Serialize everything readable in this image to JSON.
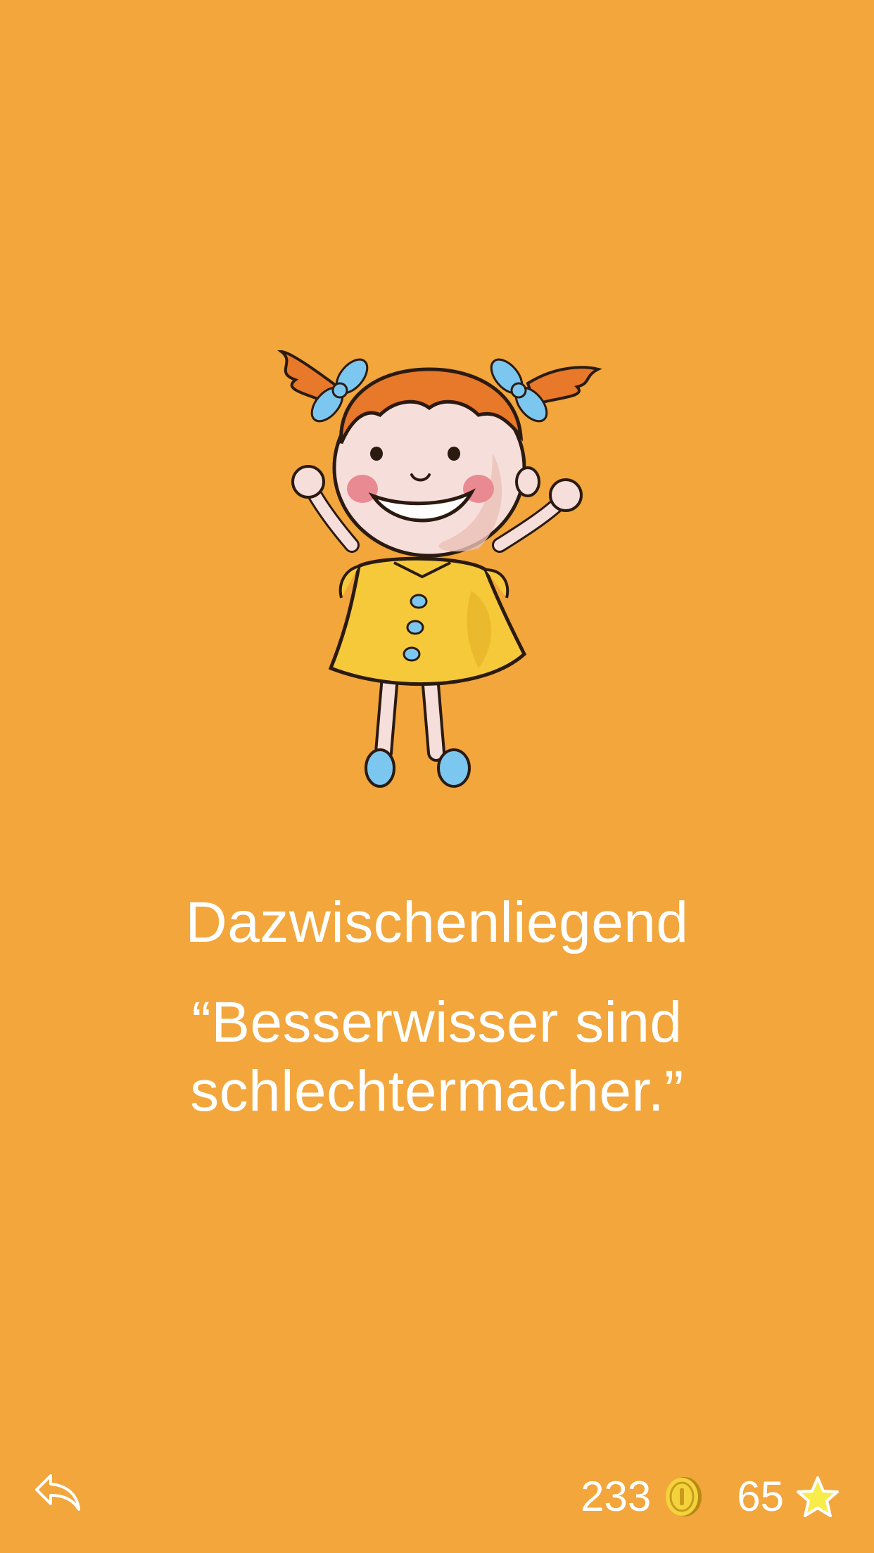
{
  "level": {
    "title": "Dazwischenliegend"
  },
  "quote": {
    "line1": "“Besserwisser sind",
    "line2": "schlechtermacher.”"
  },
  "footer": {
    "back_icon": "share-back-icon",
    "coins": "233",
    "coin_icon": "gold-coin-icon",
    "stars": "65",
    "star_icon": "yellow-star-icon"
  },
  "colors": {
    "background": "#F2A63C",
    "text": "#FFFFFF",
    "dress": "#F6C93A",
    "hair": "#E8782A",
    "accent_blue": "#7CC7EF"
  }
}
